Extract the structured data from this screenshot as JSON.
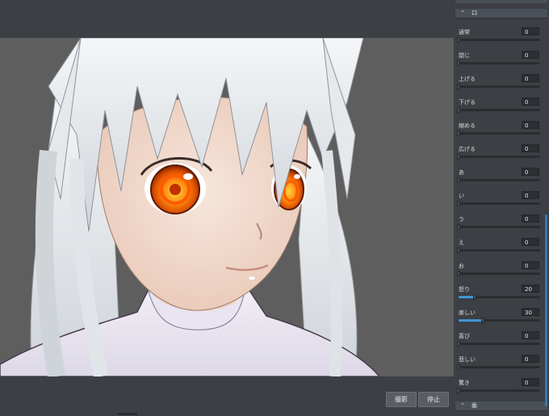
{
  "buttons": {
    "capture": "撮影",
    "stop": "停止"
  },
  "panel": {
    "section_mouth": "口",
    "section_bottom": "歯",
    "sliders": [
      {
        "label": "通常",
        "value": "0",
        "level": 0
      },
      {
        "label": "閉じ",
        "value": "0",
        "level": 0
      },
      {
        "label": "上げる",
        "value": "0",
        "level": 0
      },
      {
        "label": "下げる",
        "value": "0",
        "level": 0
      },
      {
        "label": "縮める",
        "value": "0",
        "level": 0
      },
      {
        "label": "広げる",
        "value": "0",
        "level": 0
      },
      {
        "label": "あ",
        "value": "0",
        "level": 0
      },
      {
        "label": "い",
        "value": "0",
        "level": 0
      },
      {
        "label": "う",
        "value": "0",
        "level": 0
      },
      {
        "label": "え",
        "value": "0",
        "level": 0
      },
      {
        "label": "お",
        "value": "0",
        "level": 0
      },
      {
        "label": "怒り",
        "value": "20",
        "level": 0.2
      },
      {
        "label": "楽しい",
        "value": "30",
        "level": 0.3
      },
      {
        "label": "喜び",
        "value": "0",
        "level": 0
      },
      {
        "label": "悲しい",
        "value": "0",
        "level": 0
      },
      {
        "label": "驚き",
        "value": "0",
        "level": 0
      }
    ]
  },
  "colors": {
    "accent": "#3f97d6",
    "panel_bg": "#3c3f44",
    "viewport_bg": "#5e5e5e"
  }
}
